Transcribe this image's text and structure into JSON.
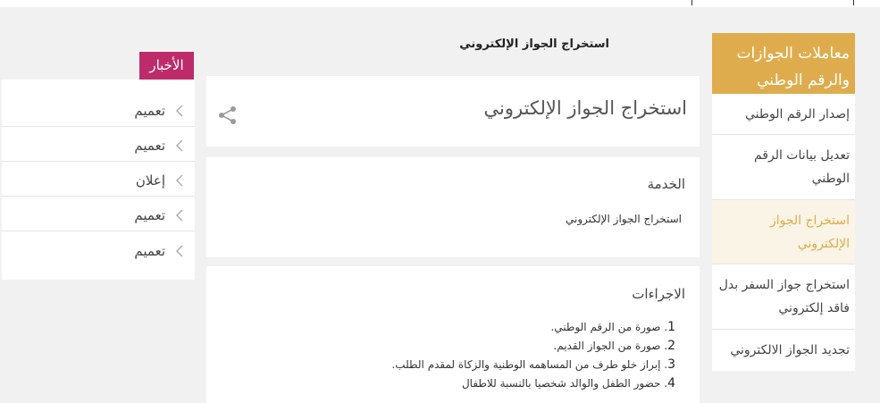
{
  "sidebar": {
    "heading": "معاملات الجوازات والرقم الوطني",
    "items": [
      {
        "label": "إصدار الرقم الوطني"
      },
      {
        "label": "تعديل بيانات الرقم الوطني"
      },
      {
        "label": "استخراج الجواز الإلكتروني",
        "active": true
      },
      {
        "label": "استخراج جواز السفر بدل فاقد إلكتروني"
      },
      {
        "label": "تجديد الجواز الالكتروني"
      }
    ],
    "accent_color": "#dfac4d"
  },
  "breadcrumb": {
    "current": "استخراج الجواز الإلكتروني"
  },
  "main": {
    "title": "استخراج الجواز الإلكتروني",
    "share_icon": "share-icon",
    "service": {
      "heading": "الخدمة",
      "value": "استخراج الجواز الإلكتروني"
    },
    "procedures": {
      "heading": "الاجراءات",
      "items": [
        {
          "num": "1",
          "text": ". صورة من الرقم الوطني."
        },
        {
          "num": "2",
          "text": ". صورة من الجواز القديم."
        },
        {
          "num": "3",
          "text": ". إبراز خلو طرف من المساهمه الوطنية والزكاة لمقدم الطلب."
        },
        {
          "num": "4",
          "text": ". حضور الطفل والوالد شخصيا بالنسبة للاطفال"
        }
      ]
    }
  },
  "news": {
    "tab_label": "الأخبار",
    "tab_color": "#bd2b6b",
    "items": [
      {
        "label": "تعميم"
      },
      {
        "label": "تعميم"
      },
      {
        "label": "إعلان"
      },
      {
        "label": "تعميم"
      },
      {
        "label": "تعميم"
      }
    ]
  }
}
